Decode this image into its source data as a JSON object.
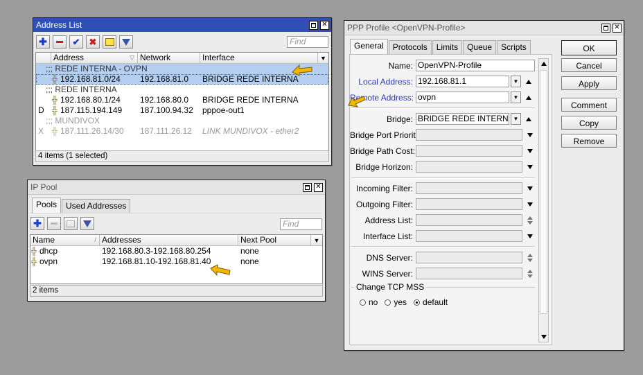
{
  "address_list": {
    "title": "Address List",
    "find_placeholder": "Find",
    "columns": [
      "Address",
      "Network",
      "Interface"
    ],
    "rows": [
      {
        "flag": "",
        "comment": ";;; REDE INTERNA - OVPN",
        "address": "",
        "network": "",
        "iface": ""
      },
      {
        "flag": "",
        "comment": "",
        "address": "192.168.81.0/24",
        "network": "192.168.81.0",
        "iface": "BRIDGE REDE INTERNA"
      },
      {
        "flag": "",
        "comment": ";;; REDE INTERNA",
        "address": "",
        "network": "",
        "iface": ""
      },
      {
        "flag": "",
        "comment": "",
        "address": "192.168.80.1/24",
        "network": "192.168.80.0",
        "iface": "BRIDGE REDE INTERNA"
      },
      {
        "flag": "D",
        "comment": "",
        "address": "187.115.194.149",
        "network": "187.100.94.32",
        "iface": "pppoe-out1"
      },
      {
        "flag": "",
        "comment": ";;; MUNDIVOX",
        "address": "",
        "network": "",
        "iface": ""
      },
      {
        "flag": "X",
        "comment": "",
        "address": "187.111.26.14/30",
        "network": "187.111.26.12",
        "iface": "LINK MUNDIVOX - ether2"
      }
    ],
    "status": "4 items (1 selected)"
  },
  "ip_pool": {
    "title": "IP Pool",
    "tabs": [
      "Pools",
      "Used Addresses"
    ],
    "find_placeholder": "Find",
    "columns": [
      "Name",
      "Addresses",
      "Next Pool"
    ],
    "rows": [
      {
        "name": "dhcp",
        "addresses": "192.168.80.3-192.168.80.254",
        "next": "none"
      },
      {
        "name": "ovpn",
        "addresses": "192.168.81.10-192.168.81.40",
        "next": "none"
      }
    ],
    "status": "2 items"
  },
  "ppp_profile": {
    "title": "PPP Profile <OpenVPN-Profile>",
    "tabs": [
      "General",
      "Protocols",
      "Limits",
      "Queue",
      "Scripts"
    ],
    "fields": {
      "name": {
        "label": "Name:",
        "value": "OpenVPN-Profile"
      },
      "local_address": {
        "label": "Local Address:",
        "value": "192.168.81.1"
      },
      "remote_address": {
        "label": "Remote Address:",
        "value": "ovpn"
      },
      "bridge": {
        "label": "Bridge:",
        "value": "BRIDGE REDE INTERNA"
      },
      "bridge_port_priority": {
        "label": "Bridge Port Priority:",
        "value": ""
      },
      "bridge_path_cost": {
        "label": "Bridge Path Cost:",
        "value": ""
      },
      "bridge_horizon": {
        "label": "Bridge Horizon:",
        "value": ""
      },
      "incoming_filter": {
        "label": "Incoming Filter:",
        "value": ""
      },
      "outgoing_filter": {
        "label": "Outgoing Filter:",
        "value": ""
      },
      "address_list": {
        "label": "Address List:",
        "value": ""
      },
      "interface_list": {
        "label": "Interface List:",
        "value": ""
      },
      "dns_server": {
        "label": "DNS Server:",
        "value": ""
      },
      "wins_server": {
        "label": "WINS Server:",
        "value": ""
      }
    },
    "change_tcp_mss": {
      "label": "Change TCP MSS",
      "options": [
        "no",
        "yes",
        "default"
      ],
      "selected": "default"
    },
    "buttons": [
      "OK",
      "Cancel",
      "Apply",
      "Comment",
      "Copy",
      "Remove"
    ]
  },
  "colors": {
    "active_title": "#2f4fb7",
    "selected_row": "#b5cff0",
    "link_label": "#2c37b2",
    "pointer": "#f5b800"
  }
}
